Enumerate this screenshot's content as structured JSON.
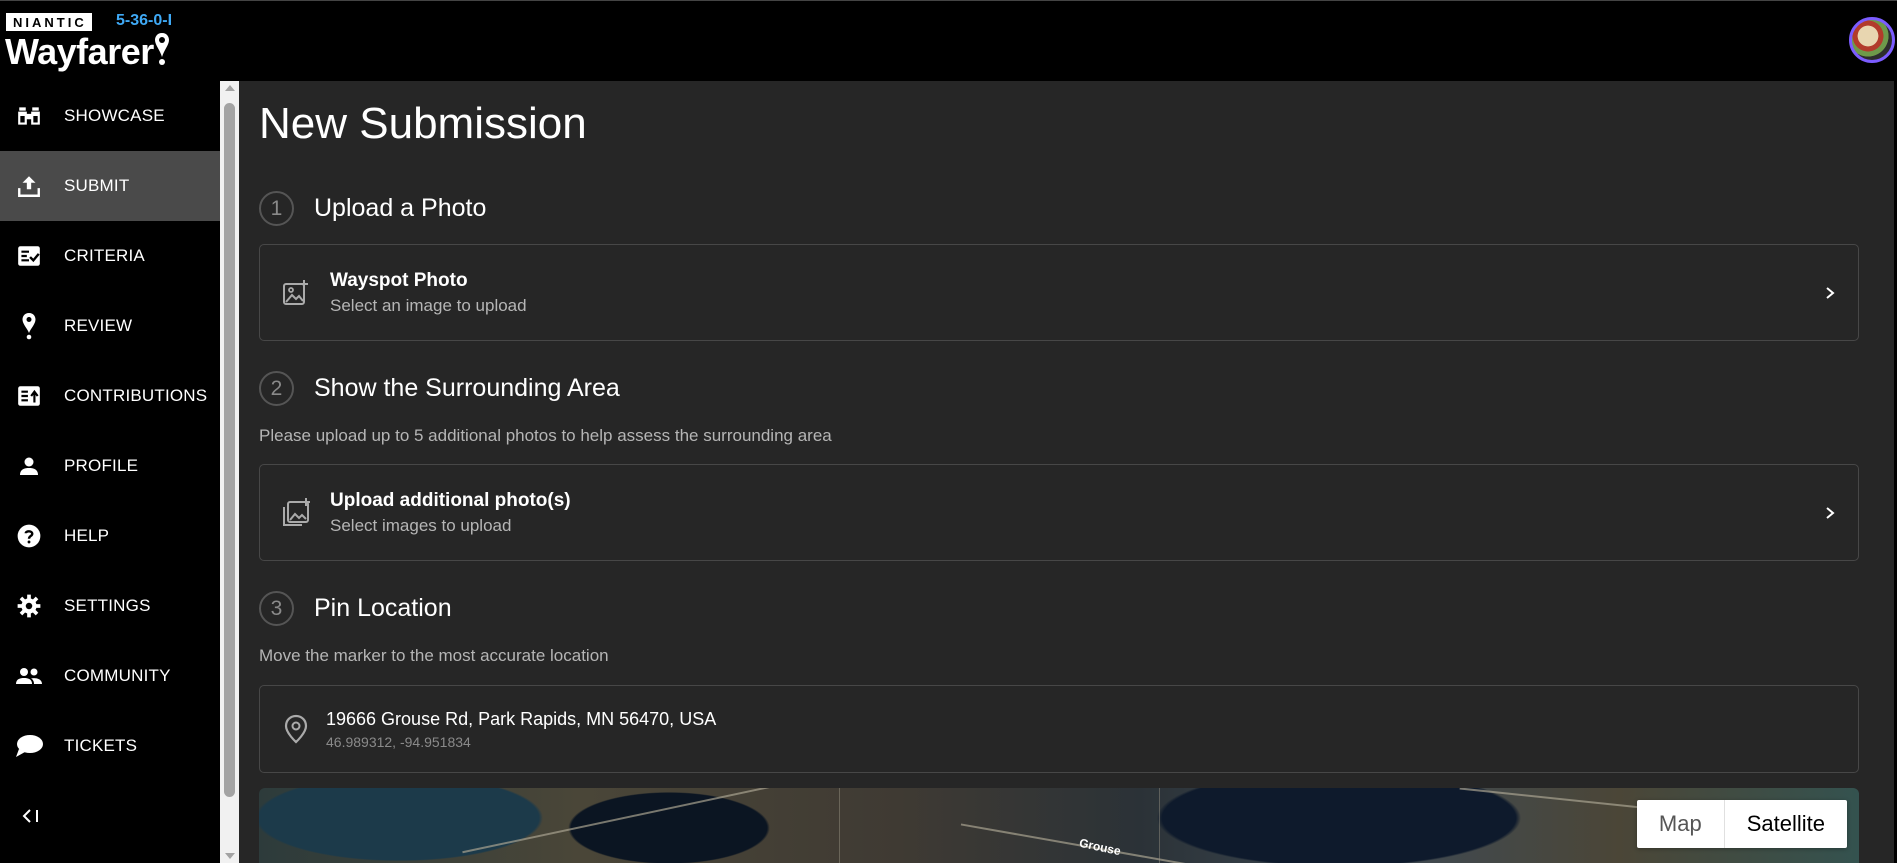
{
  "header": {
    "brand": "NIANTIC",
    "version": "5-36-0-I",
    "app_name": "Wayfarer"
  },
  "sidebar": {
    "items": [
      {
        "label": "SHOWCASE",
        "icon": "binoculars-icon"
      },
      {
        "label": "SUBMIT",
        "icon": "upload-icon",
        "active": true
      },
      {
        "label": "CRITERIA",
        "icon": "checklist-icon"
      },
      {
        "label": "REVIEW",
        "icon": "pin-icon"
      },
      {
        "label": "CONTRIBUTIONS",
        "icon": "contributions-icon"
      },
      {
        "label": "PROFILE",
        "icon": "person-icon"
      },
      {
        "label": "HELP",
        "icon": "help-icon"
      },
      {
        "label": "SETTINGS",
        "icon": "gear-icon"
      },
      {
        "label": "COMMUNITY",
        "icon": "group-icon"
      },
      {
        "label": "TICKETS",
        "icon": "chat-bubble-icon"
      }
    ],
    "collapse_label": "<|"
  },
  "main": {
    "title": "New Submission",
    "steps": [
      {
        "number": "1",
        "title": "Upload a Photo"
      },
      {
        "number": "2",
        "title": "Show the Surrounding Area",
        "description": "Please upload up to 5 additional photos to help assess the surrounding area"
      },
      {
        "number": "3",
        "title": "Pin Location",
        "description": "Move the marker to the most accurate location"
      }
    ],
    "photo_card": {
      "title": "Wayspot Photo",
      "subtitle": "Select an image to upload"
    },
    "additional_card": {
      "title": "Upload additional photo(s)",
      "subtitle": "Select images to upload"
    },
    "location": {
      "address": "19666 Grouse Rd, Park Rapids, MN 56470, USA",
      "coords": "46.989312, -94.951834"
    },
    "map": {
      "road_label": "Grouse",
      "toggle_map": "Map",
      "toggle_satellite": "Satellite",
      "selected": "Satellite"
    }
  },
  "colors": {
    "active_nav": "#4a4a4a",
    "main_bg": "#262626",
    "version": "#3fa9f5"
  }
}
